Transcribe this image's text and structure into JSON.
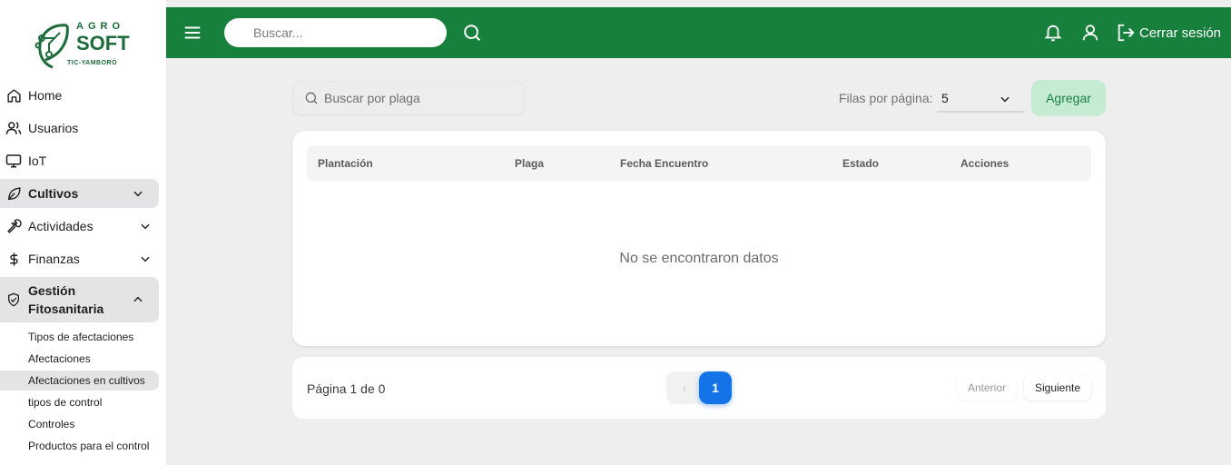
{
  "colors": {
    "topbar": "#17803d",
    "accent_blue": "#1473e6",
    "add_button_bg": "#c5ecd3",
    "add_button_text": "#17803d"
  },
  "logo": {
    "line1": "AGRO",
    "line2": "SOFT",
    "line3": "TIC-YAMBORÓ"
  },
  "topbar": {
    "search_placeholder": "Buscar...",
    "logout_label": "Cerrar sesión",
    "icons": [
      "menu-icon",
      "search-icon",
      "bell-icon",
      "user-icon",
      "logout-icon"
    ]
  },
  "sidebar": {
    "items": [
      {
        "label": "Home",
        "icon": "home-icon"
      },
      {
        "label": "Usuarios",
        "icon": "users-icon"
      },
      {
        "label": "IoT",
        "icon": "monitor-icon"
      },
      {
        "label": "Cultivos",
        "icon": "leaf-icon"
      },
      {
        "label": "Actividades",
        "icon": "wrench-icon"
      },
      {
        "label": "Finanzas",
        "icon": "dollar-icon"
      },
      {
        "label_line1": "Gestión",
        "label_line2": "Fitosanitaria",
        "icon": "shield-icon"
      }
    ],
    "subitems": [
      {
        "label": "Tipos de afectaciones"
      },
      {
        "label": "Afectaciones"
      },
      {
        "label": "Afectaciones en cultivos"
      },
      {
        "label": "tipos de control"
      },
      {
        "label": "Controles"
      },
      {
        "label": "Productos para el control"
      }
    ]
  },
  "main": {
    "search_placeholder": "Buscar por plaga",
    "rows_per_page_label": "Filas por página:",
    "rows_per_page_value": "5",
    "add_label": "Agregar",
    "columns": [
      "Plantación",
      "Plaga",
      "Fecha Encuentro",
      "Estado",
      "Acciones"
    ],
    "empty_text": "No se encontraron datos",
    "pagination": {
      "info": "Página 1 de 0",
      "prev_symbol": "‹",
      "current_page": "1",
      "prev_label": "Anterior",
      "next_label": "Siguiente"
    }
  }
}
